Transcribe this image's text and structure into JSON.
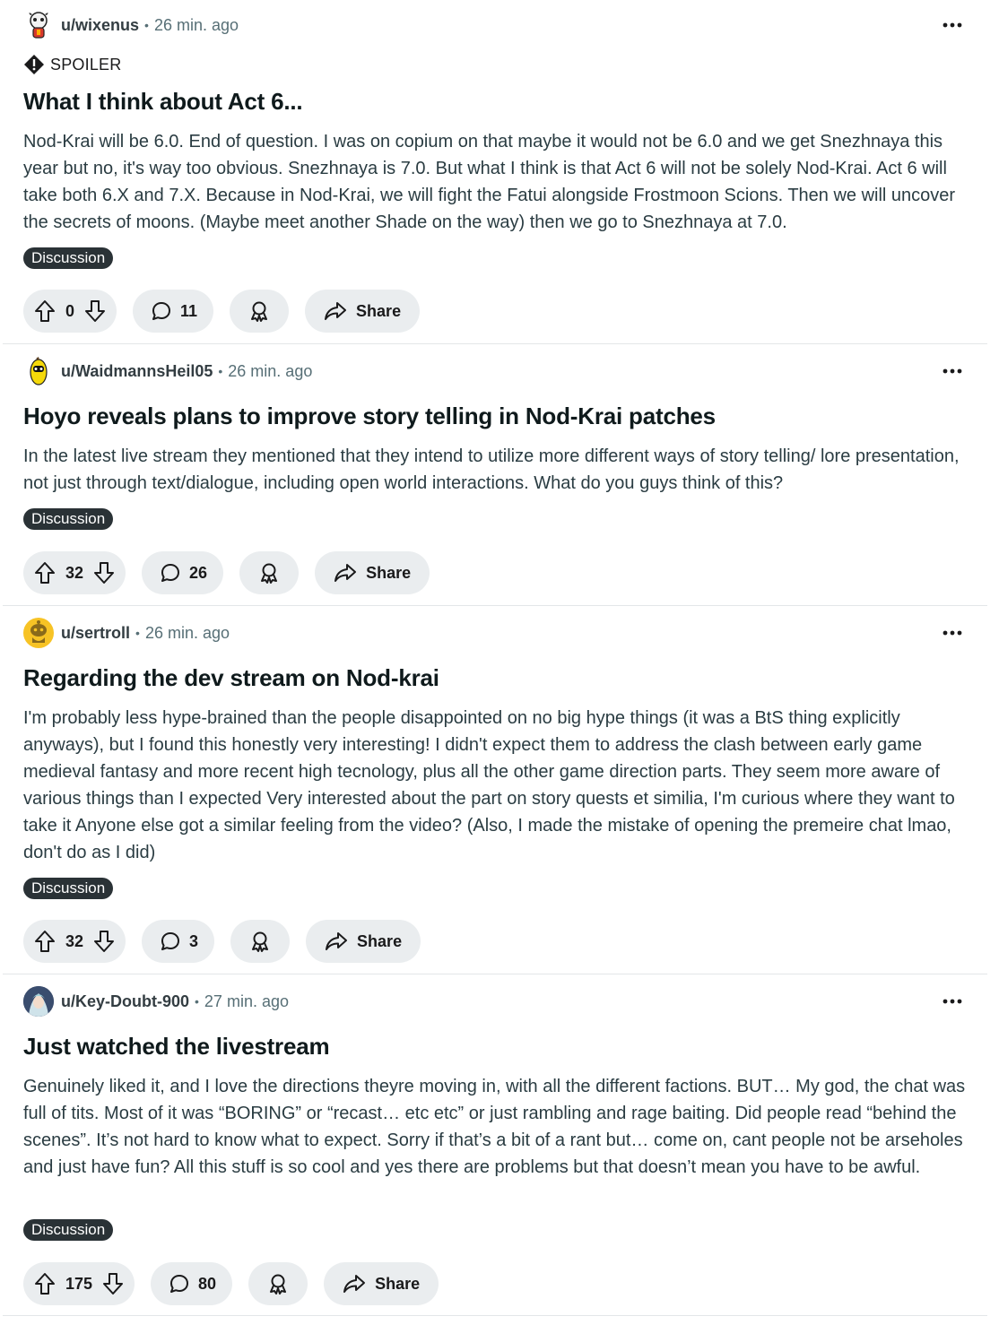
{
  "posts": [
    {
      "username": "u/wixenus",
      "time": "26 min. ago",
      "spoiler": "SPOILER",
      "title": "What I think about Act 6...",
      "body": "Nod-Krai will be 6.0. End of question. I was on copium on that maybe it would not be 6.0 and we get Snezhnaya this year but no, it's way too obvious. Snezhnaya is 7.0. But what I think is that Act 6 will not be solely Nod-Krai. Act 6 will take both 6.X and 7.X. Because in Nod-Krai, we will fight the Fatui alongside Frostmoon Scions. Then we will uncover the secrets of moons. (Maybe meet another Shade on the way) then we go to Snezhnaya at 7.0.",
      "flair": "Discussion",
      "score": "0",
      "comments": "11",
      "share": "Share"
    },
    {
      "username": "u/WaidmannsHeil05",
      "time": "26 min. ago",
      "title": "Hoyo reveals plans to improve story telling in Nod-Krai patches",
      "body": "In the latest live stream they mentioned that they intend to utilize more different ways of story telling/ lore presentation, not just through text/dialogue, including open world interactions. What do you guys think of this?",
      "flair": "Discussion",
      "score": "32",
      "comments": "26",
      "share": "Share"
    },
    {
      "username": "u/sertroll",
      "time": "26 min. ago",
      "title": "Regarding the dev stream on Nod-krai",
      "body": "I'm probably less hype-brained than the people disappointed on no big hype things (it was a BtS thing explicitly anyways), but I found this honestly very interesting! I didn't expect them to address the clash between early game medieval fantasy and more recent high tecnology, plus all the other game direction parts. They seem more aware of various things than I expected Very interested about the part on story quests et similia, I'm curious where they want to take it Anyone else got a similar feeling from the video? (Also, I made the mistake of opening the premeire chat lmao, don't do as I did)",
      "flair": "Discussion",
      "score": "32",
      "comments": "3",
      "share": "Share"
    },
    {
      "username": "u/Key-Doubt-900",
      "time": "27 min. ago",
      "title": "Just watched the livestream",
      "body": "Genuinely liked it, and I love the directions theyre moving in, with all the different factions. BUT… My god, the chat was full of tits. Most of it was “BORING” or “recast… etc etc” or just rambling and rage baiting. Did people read “behind the scenes”. It’s not hard to know what to expect. Sorry if that’s a bit of a rant but… come on, cant people not be arseholes and just have fun? All this stuff is so cool and yes there are problems but that doesn’t mean you have to be awful.",
      "flair": "Discussion",
      "score": "175",
      "comments": "80",
      "share": "Share"
    }
  ]
}
